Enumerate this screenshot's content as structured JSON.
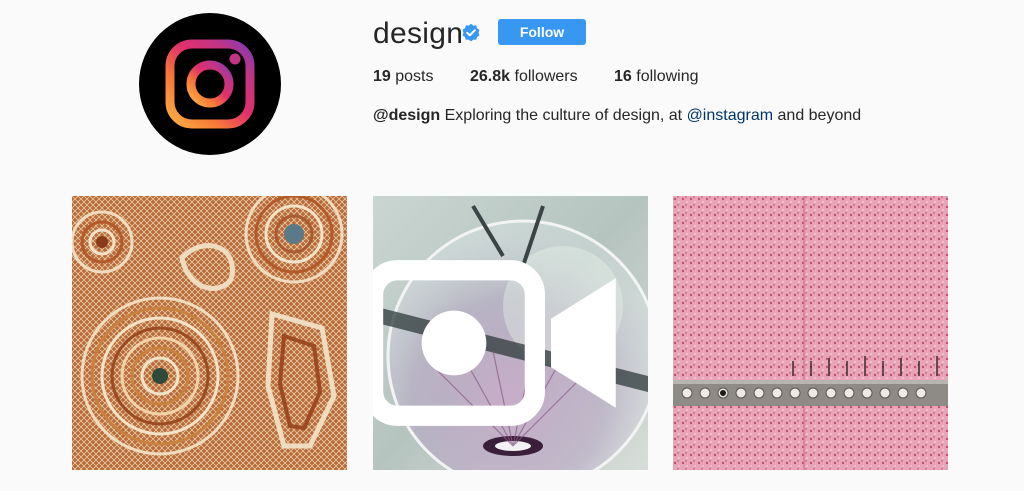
{
  "profile": {
    "username": "design",
    "verified": true,
    "follow_label": "Follow",
    "avatar_icon": "instagram-logo-icon"
  },
  "stats": {
    "posts_count": "19",
    "posts_label": "posts",
    "followers_count": "26.8k",
    "followers_label": "followers",
    "following_count": "16",
    "following_label": "following"
  },
  "bio": {
    "handle": "@design",
    "text_before": "Exploring the culture of design, at",
    "mention": "@instagram",
    "text_after": "and beyond"
  },
  "posts": [
    {
      "id": "post-1",
      "icon": "none"
    },
    {
      "id": "post-2",
      "icon": "video-icon"
    },
    {
      "id": "post-3",
      "icon": "none"
    }
  ],
  "colors": {
    "accent": "#3897f0",
    "background": "#fafafa",
    "text": "#262626",
    "mention": "#003569"
  }
}
